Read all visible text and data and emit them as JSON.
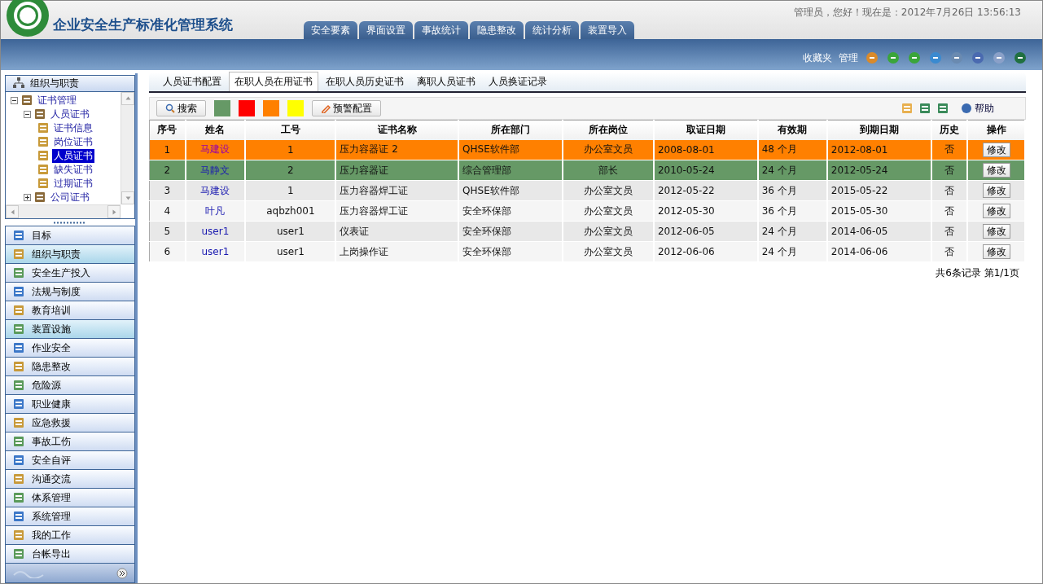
{
  "app": {
    "title": "企业安全生产标准化管理系统",
    "greeting": "管理员，您好！现在是：2012年7月26日  13:56:13"
  },
  "nav_tabs": [
    {
      "label": "安全要素"
    },
    {
      "label": "界面设置"
    },
    {
      "label": "事故统计"
    },
    {
      "label": "隐患整改"
    },
    {
      "label": "统计分析"
    },
    {
      "label": "装置导入"
    }
  ],
  "toolbar_links": [
    "收藏夹",
    "管理"
  ],
  "sidebar": {
    "header": "组织与职责",
    "tree": [
      {
        "label": "证书管理",
        "expanded": true,
        "children": [
          {
            "label": "人员证书",
            "expanded": true,
            "children": [
              {
                "label": "证书信息",
                "selected": false
              },
              {
                "label": "岗位证书",
                "selected": false
              },
              {
                "label": "人员证书",
                "selected": true
              },
              {
                "label": "缺失证书",
                "selected": false
              },
              {
                "label": "过期证书",
                "selected": false
              }
            ]
          },
          {
            "label": "公司证书",
            "expanded": false
          }
        ]
      }
    ],
    "items": [
      {
        "label": "目标",
        "selected": false
      },
      {
        "label": "组织与职责",
        "selected": true
      },
      {
        "label": "安全生产投入",
        "selected": false
      },
      {
        "label": "法规与制度",
        "selected": false
      },
      {
        "label": "教育培训",
        "selected": false
      },
      {
        "label": "装置设施",
        "selected": true
      },
      {
        "label": "作业安全",
        "selected": false
      },
      {
        "label": "隐患整改",
        "selected": false
      },
      {
        "label": "危险源",
        "selected": false
      },
      {
        "label": "职业健康",
        "selected": false
      },
      {
        "label": "应急救援",
        "selected": false
      },
      {
        "label": "事故工伤",
        "selected": false
      },
      {
        "label": "安全自评",
        "selected": false
      },
      {
        "label": "沟通交流",
        "selected": false
      },
      {
        "label": "体系管理",
        "selected": false
      },
      {
        "label": "系统管理",
        "selected": false
      },
      {
        "label": "我的工作",
        "selected": false
      },
      {
        "label": "台帐导出",
        "selected": false
      }
    ]
  },
  "sub_tabs": [
    {
      "label": "人员证书配置",
      "selected": false
    },
    {
      "label": "在职人员在用证书",
      "selected": true
    },
    {
      "label": "在职人员历史证书",
      "selected": false
    },
    {
      "label": "离职人员证书",
      "selected": false
    },
    {
      "label": "人员换证记录",
      "selected": false
    }
  ],
  "actions": {
    "search": "搜索",
    "legend": [
      {
        "color": "#669966"
      },
      {
        "color": "#ff0000"
      },
      {
        "color": "#ff8000"
      },
      {
        "color": "#ffff00"
      }
    ],
    "alert_config": "预警配置",
    "help": "帮助"
  },
  "table": {
    "columns": [
      "序号",
      "姓名",
      "工号",
      "证书名称",
      "所在部门",
      "所在岗位",
      "取证日期",
      "有效期",
      "到期日期",
      "历史",
      "操作"
    ],
    "rows": [
      {
        "color": "#ff8000",
        "cells": [
          "1",
          "马建设",
          "1",
          "压力容器证  2",
          "QHSE软件部",
          "办公室文员",
          "2008-08-01",
          "48 个月",
          "2012-08-01",
          "否"
        ],
        "action": "修改"
      },
      {
        "color": "#669966",
        "cells": [
          "2",
          "马静文",
          "2",
          "压力容器证",
          "综合管理部",
          "部长",
          "2010-05-24",
          "24 个月",
          "2012-05-24",
          "否"
        ],
        "action": "修改"
      },
      {
        "cells": [
          "3",
          "马建设",
          "1",
          "压力容器焊工证",
          "QHSE软件部",
          "办公室文员",
          "2012-05-22",
          "36 个月",
          "2015-05-22",
          "否"
        ],
        "action": "修改"
      },
      {
        "cells": [
          "4",
          "叶凡",
          "aqbzh001",
          "压力容器焊工证",
          "安全环保部",
          "办公室文员",
          "2012-05-30",
          "36 个月",
          "2015-05-30",
          "否"
        ],
        "action": "修改"
      },
      {
        "cells": [
          "5",
          "user1",
          "user1",
          "仪表证",
          "安全环保部",
          "办公室文员",
          "2012-06-05",
          "24 个月",
          "2014-06-05",
          "否"
        ],
        "action": "修改"
      },
      {
        "cells": [
          "6",
          "user1",
          "user1",
          "上岗操作证",
          "安全环保部",
          "办公室文员",
          "2012-06-06",
          "24 个月",
          "2014-06-06",
          "否"
        ],
        "action": "修改"
      }
    ]
  },
  "pagination": "共6条记录 第1/1页"
}
